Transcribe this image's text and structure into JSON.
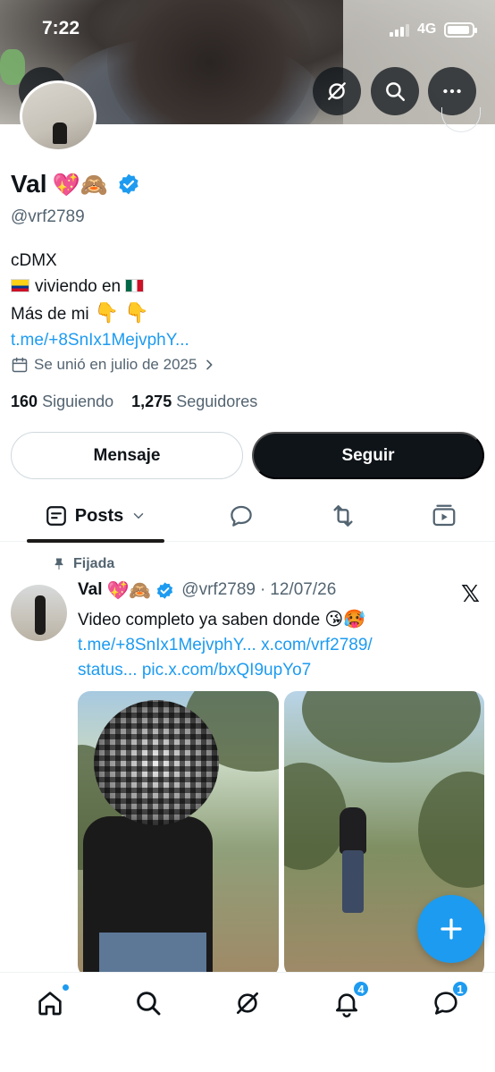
{
  "status_bar": {
    "time": "7:22",
    "network": "4G"
  },
  "profile": {
    "name": "Val",
    "name_emojis": "💖🙈",
    "handle": "@vrf2789",
    "bio": {
      "line1": "cDMX",
      "line2": "viviendo en",
      "line3": "Más de mi",
      "link": "t.me/+8SnIx1MejvphY..."
    },
    "joined": "Se unió en julio de 2025",
    "following_count": "160",
    "following_label": "Siguiendo",
    "followers_count": "1,275",
    "followers_label": "Seguidores"
  },
  "actions": {
    "message_label": "Mensaje",
    "follow_label": "Seguir"
  },
  "tabs": {
    "posts_label": "Posts"
  },
  "pinned_post": {
    "pinned_label": "Fijada",
    "author_name": "Val",
    "author_emojis": "💖🙈",
    "author_handle": "@vrf2789",
    "date": "12/07/26",
    "text": "Video completo ya saben donde",
    "text_emojis": "😘🥵",
    "link1": "t.me/+8SnIx1MejvphY...",
    "link2": "x.com/vrf2789/",
    "link3": "status...",
    "link4": "pic.x.com/bxQI9upYo7"
  },
  "bottom_nav": {
    "notifications_badge": "4",
    "messages_badge": "1"
  },
  "colors": {
    "accent": "#1d9bf0",
    "text": "#0f1419",
    "secondary": "#536471",
    "follow_button": "#0f1419"
  },
  "icons": [
    "back-arrow-icon",
    "grok-icon",
    "search-icon",
    "more-icon",
    "verified-icon",
    "calendar-icon",
    "chevron-right-icon",
    "posts-icon",
    "chevron-down-icon",
    "replies-icon",
    "reposts-icon",
    "media-icon",
    "pin-icon",
    "x-logo-icon",
    "plus-icon",
    "home-icon",
    "bell-icon",
    "messages-icon"
  ]
}
